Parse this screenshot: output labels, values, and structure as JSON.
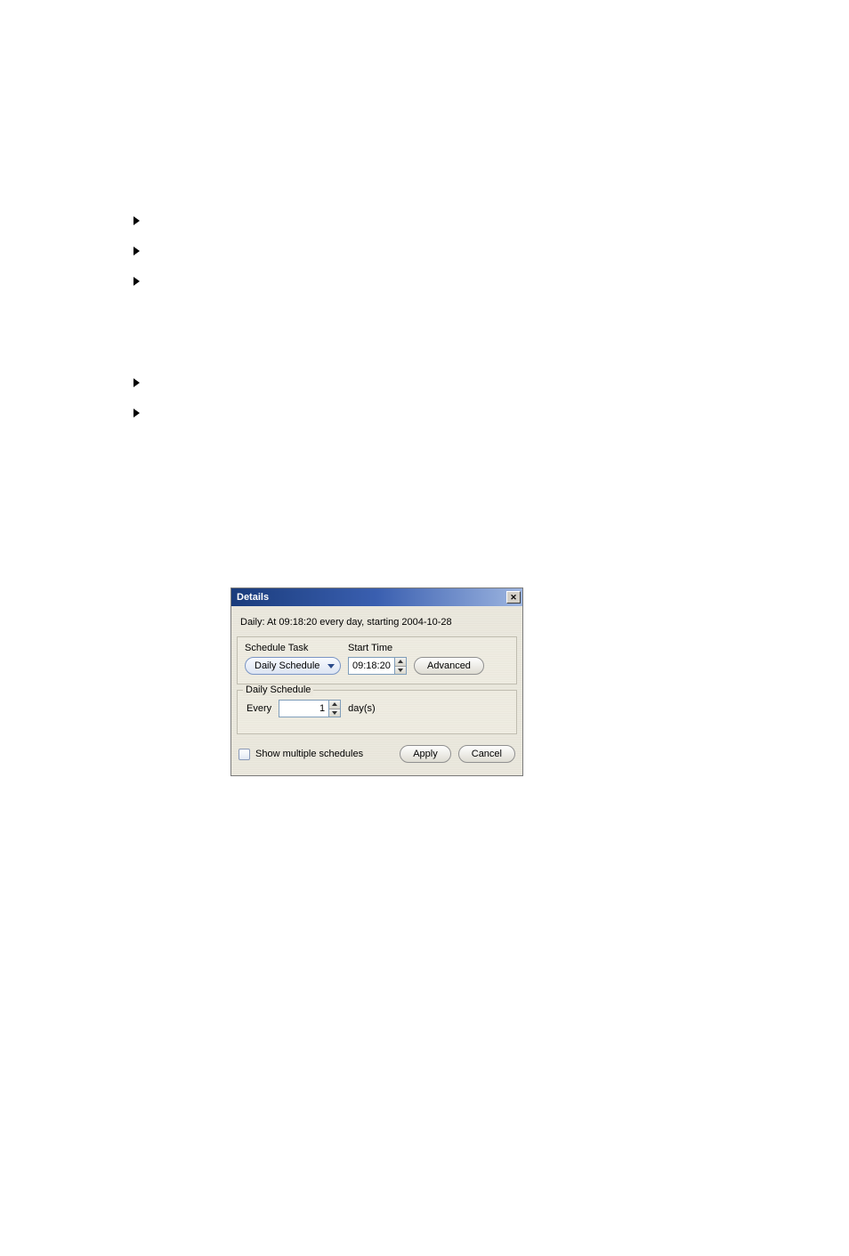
{
  "bullets_top_count": 3,
  "bullets_bottom_count": 2,
  "dialog": {
    "title": "Details",
    "summary": "Daily: At 09:18:20 every day, starting 2004-10-28",
    "schedule_task_label": "Schedule Task",
    "start_time_label": "Start Time",
    "dropdown_value": "Daily Schedule",
    "start_time_value": "09:18:20",
    "advanced_label": "Advanced",
    "daily_schedule_legend": "Daily Schedule",
    "every_label": "Every",
    "every_value": "1",
    "days_label": "day(s)",
    "show_multiple_label": "Show multiple schedules",
    "apply_label": "Apply",
    "cancel_label": "Cancel"
  }
}
